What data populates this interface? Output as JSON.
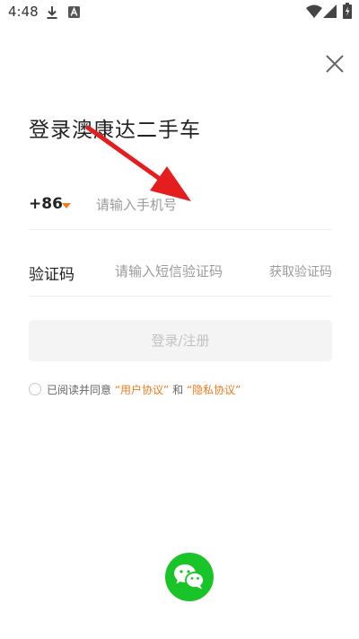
{
  "status_bar": {
    "time": "4:48",
    "left_icons": [
      "download-icon",
      "a-notification-icon"
    ],
    "right_icons": [
      "wifi-icon",
      "signal-icon",
      "battery-icon"
    ]
  },
  "header": {
    "close_icon": "close-icon"
  },
  "title": "登录澳康达二手车",
  "phone": {
    "country_code": "+86",
    "placeholder": "请输入手机号",
    "value": ""
  },
  "verification": {
    "label": "验证码",
    "placeholder": "请输入短信验证码",
    "value": "",
    "get_code_label": "获取验证码"
  },
  "login_button": {
    "label": "登录/注册"
  },
  "agreement": {
    "prefix": "已阅读并同意",
    "user_agreement": "“用户协议”",
    "conjunction": "和",
    "privacy_policy": "“隐私协议”",
    "checked": false
  },
  "third_party": {
    "icon": "wechat-icon"
  },
  "colors": {
    "accent": "#f07b1f",
    "wechat": "#18c427",
    "disabled_button_bg": "#f4f4f4",
    "annotation_arrow": "#e41e1e"
  }
}
